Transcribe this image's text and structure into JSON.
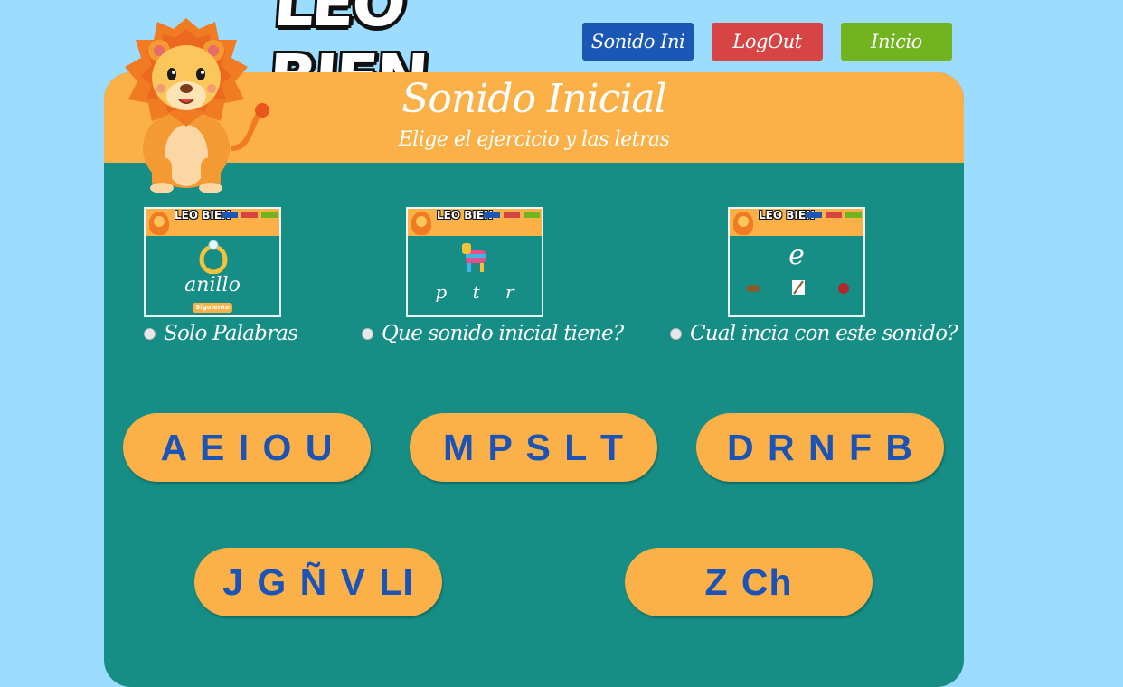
{
  "app": {
    "logo_text": "LEO BIEN"
  },
  "nav": {
    "sonido_label": "Sonido Ini",
    "logout_label": "LogOut",
    "inicio_label": "Inicio"
  },
  "panel": {
    "title": "Sonido Inicial",
    "subtitle": "Elige el ejercicio y las letras"
  },
  "exercises": [
    {
      "label": "Solo Palabras",
      "preview_word": "anillo",
      "preview_button": "Siguiente"
    },
    {
      "label": "Que sonido inicial tiene?",
      "preview_letters": [
        "p",
        "t",
        "r"
      ]
    },
    {
      "label": "Cual incia con este sonido?",
      "preview_letter": "e"
    }
  ],
  "letter_groups": [
    {
      "label": "A E I O U"
    },
    {
      "label": "M P S L T"
    },
    {
      "label": "D R N F B"
    },
    {
      "label": "J G Ñ V LI"
    },
    {
      "label": "Z Ch"
    }
  ],
  "colors": {
    "background": "#9cdcff",
    "panel": "#168d85",
    "header": "#fbb147",
    "letter_text": "#1b53b6",
    "nav_blue": "#1b58b6",
    "nav_red": "#d64444",
    "nav_green": "#72b41f"
  }
}
